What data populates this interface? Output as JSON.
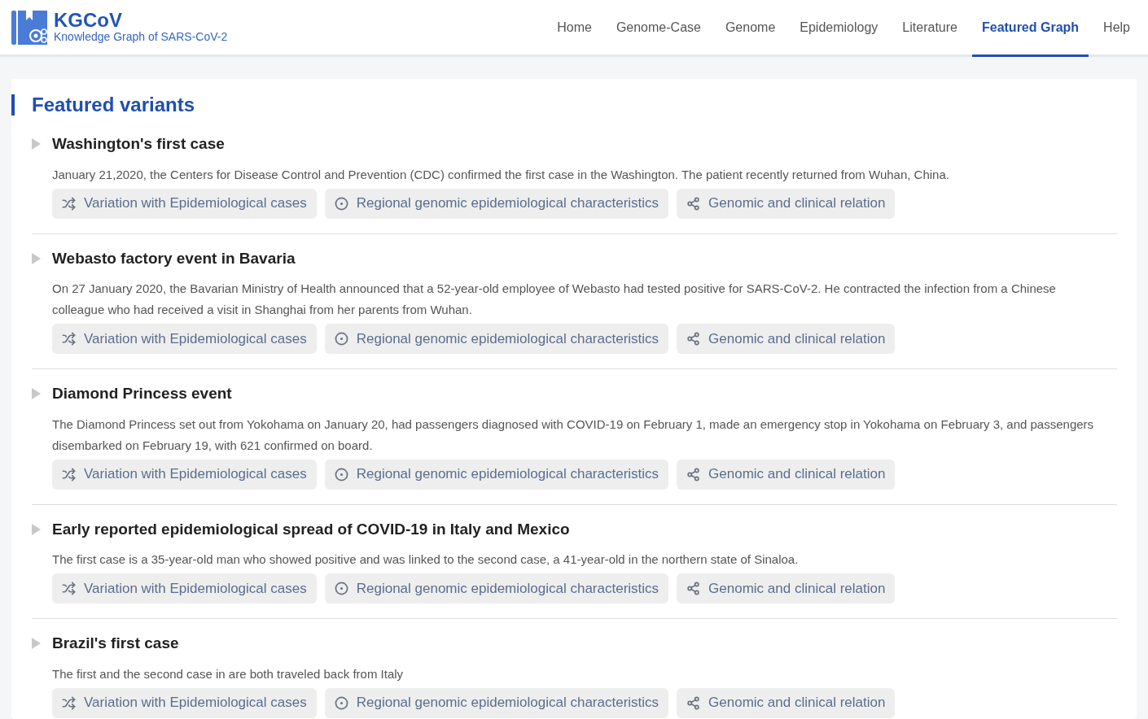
{
  "header": {
    "logo_title": "KGCoV",
    "logo_subtitle": "Knowledge Graph of SARS-CoV-2",
    "nav": [
      {
        "label": "Home",
        "selected": false
      },
      {
        "label": "Genome-Case",
        "selected": false
      },
      {
        "label": "Genome",
        "selected": false
      },
      {
        "label": "Epidemiology",
        "selected": false
      },
      {
        "label": "Literature",
        "selected": false
      },
      {
        "label": "Featured Graph",
        "selected": true
      },
      {
        "label": "Help",
        "selected": false
      }
    ]
  },
  "section": {
    "title": "Featured variants",
    "cases": [
      {
        "title": "Washington's first case",
        "expanded": false,
        "description": "January 21,2020, the Centers for Disease Control and Prevention (CDC) confirmed the first case in the Washington. The patient recently returned from Wuhan, China.",
        "buttons": [
          {
            "kind": "shuffle",
            "label": "Variation with Epidemiological cases"
          },
          {
            "kind": "target",
            "label": "Regional genomic epidemiological characteristics"
          },
          {
            "kind": "share",
            "label": "Genomic and clinical relation"
          }
        ]
      },
      {
        "title": "Webasto factory event in Bavaria",
        "expanded": false,
        "description": "On 27 January 2020, the Bavarian Ministry of Health announced that a 52-year-old employee of Webasto had tested positive for SARS-CoV-2. He contracted the infection from a Chinese colleague who had received a visit in Shanghai from her parents from Wuhan.",
        "buttons": [
          {
            "kind": "shuffle",
            "label": "Variation with Epidemiological cases"
          },
          {
            "kind": "target",
            "label": "Regional genomic epidemiological characteristics"
          },
          {
            "kind": "share",
            "label": "Genomic and clinical relation"
          }
        ]
      },
      {
        "title": "Diamond Princess event",
        "expanded": false,
        "description": "The Diamond Princess set out from Yokohama on January 20, had passengers diagnosed with COVID-19 on February 1, made an emergency stop in Yokohama on February 3, and passengers disembarked on February 19, with 621 confirmed on board.",
        "buttons": [
          {
            "kind": "shuffle",
            "label": "Variation with Epidemiological cases"
          },
          {
            "kind": "target",
            "label": "Regional genomic epidemiological characteristics"
          },
          {
            "kind": "share",
            "label": "Genomic and clinical relation"
          }
        ]
      },
      {
        "title": "Early reported epidemiological spread of COVID-19 in Italy and Mexico",
        "expanded": false,
        "description": "The first case is a 35-year-old man who showed positive and was linked to the second case, a 41-year-old in the northern state of Sinaloa.",
        "buttons": [
          {
            "kind": "shuffle",
            "label": "Variation with Epidemiological cases"
          },
          {
            "kind": "target",
            "label": "Regional genomic epidemiological characteristics"
          },
          {
            "kind": "share",
            "label": "Genomic and clinical relation"
          }
        ]
      },
      {
        "title": "Brazil's first case",
        "expanded": false,
        "description": "The first and the second case in are both traveled back from Italy",
        "buttons": [
          {
            "kind": "shuffle",
            "label": "Variation with Epidemiological cases"
          },
          {
            "kind": "target",
            "label": "Regional genomic epidemiological characteristics"
          },
          {
            "kind": "share",
            "label": "Genomic and clinical relation"
          }
        ]
      }
    ]
  }
}
